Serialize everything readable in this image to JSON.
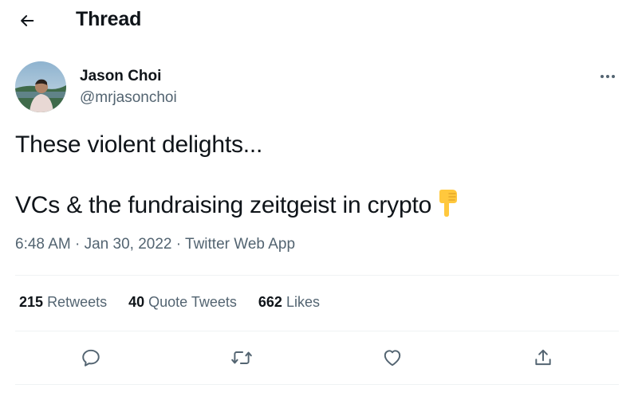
{
  "header": {
    "title": "Thread",
    "back_icon": "arrow-left-icon"
  },
  "tweet": {
    "author": {
      "name": "Jason Choi",
      "handle": "@mrjasonchoi"
    },
    "text_line1": "These violent delights...",
    "text_line2": "VCs & the fundraising zeitgeist in crypto",
    "emoji": "backhand-index-pointing-down",
    "time": "6:48 AM",
    "separator": "·",
    "date": "Jan 30, 2022",
    "source": "Twitter Web App",
    "stats": {
      "retweets_count": "215",
      "retweets_label": "Retweets",
      "quotes_count": "40",
      "quotes_label": "Quote Tweets",
      "likes_count": "662",
      "likes_label": "Likes"
    },
    "actions": [
      "reply-icon",
      "retweet-icon",
      "like-icon",
      "share-icon"
    ]
  },
  "colors": {
    "text": "#0f1419",
    "secondary": "#536471",
    "divider": "#eff3f4",
    "emoji": "#ffc83d"
  }
}
